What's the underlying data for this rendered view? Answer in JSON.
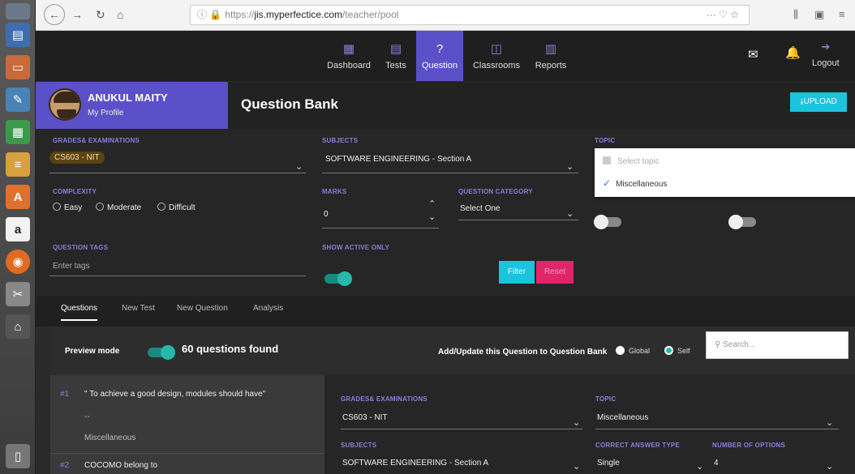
{
  "browser": {
    "url_host": "jis.myperfectice.com",
    "url_prefix": "https://",
    "url_path": "/teacher/pool",
    "url_actions": "··· ♡ ☆"
  },
  "nav": {
    "tabs": [
      {
        "label": "Dashboard",
        "icon": "grid-icon"
      },
      {
        "label": "Tests",
        "icon": "document-icon"
      },
      {
        "label": "Question",
        "icon": "question-icon"
      },
      {
        "label": "Classrooms",
        "icon": "classroom-icon"
      },
      {
        "label": "Reports",
        "icon": "chart-icon"
      }
    ],
    "logout_label": "Logout"
  },
  "profile": {
    "name": "ANUKUL MAITY",
    "link": "My Profile"
  },
  "page": {
    "title": "Question Bank",
    "upload_label": "UPLOAD"
  },
  "filters": {
    "grades_label": "GRADES& EXAMINATIONS",
    "grades_value": "CS603 - NIT",
    "subjects_label": "SUBJECTS",
    "subjects_value": "SOFTWARE ENGINEERING - Section A",
    "topic_label": "TOPIC",
    "topic_options": [
      "Select topic",
      "Miscellaneous"
    ],
    "complexity_label": "COMPLEXITY",
    "complexity_options": [
      "Easy",
      "Moderate",
      "Difficult"
    ],
    "marks_label": "MARKS",
    "marks_value": "0",
    "qcat_label": "QUESTION CATEGORY",
    "qcat_value": "Select One",
    "tags_label": "QUESTION TAGS",
    "tags_placeholder": "Enter tags",
    "active_label": "SHOW ACTIVE ONLY",
    "filter_label": "Filter",
    "reset_label": "Reset"
  },
  "subtabs": [
    "Questions",
    "New Test",
    "New Question",
    "Analysis"
  ],
  "preview": {
    "label": "Preview mode",
    "found": "60 questions found",
    "addupdate": "Add/Update this Question to Question Bank",
    "global_label": "Global",
    "self_label": "Self",
    "search_placeholder": "Search..."
  },
  "questions": [
    {
      "num": "#1",
      "text": "\" To achieve a good design, modules should have\"",
      "dash": "--",
      "topic": "Miscellaneous"
    },
    {
      "num": "#2",
      "text": "COCOMO belong to"
    }
  ],
  "detail": {
    "grades_label": "GRADES& EXAMINATIONS",
    "grades_value": "CS603 - NIT",
    "topic_label": "TOPIC",
    "topic_value": "Miscellaneous",
    "subjects_label": "SUBJECTS",
    "subjects_value": "SOFTWARE ENGINEERING - Section A",
    "answer_type_label": "CORRECT ANSWER TYPE",
    "answer_type_value": "Single",
    "options_label": "NUMBER OF OPTIONS",
    "options_value": "4"
  },
  "colors": {
    "accent": "#5a50c8",
    "cyan": "#19c4dc",
    "pink": "#e0256a",
    "teal": "#26b9a8"
  }
}
